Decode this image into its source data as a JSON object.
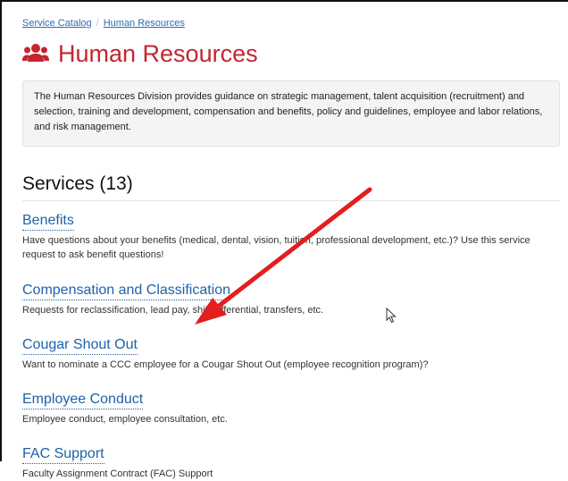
{
  "breadcrumb": {
    "items": [
      "Service Catalog",
      "Human Resources"
    ],
    "separator": "/"
  },
  "header": {
    "title": "Human Resources",
    "icon": "users-icon",
    "title_color": "#c3262e"
  },
  "description": "The Human Resources Division provides guidance on strategic management, talent acquisition (recruitment) and selection, training and development, compensation and benefits, policy and guidelines, employee and labor relations, and risk management.",
  "services": {
    "heading": "Services (13)",
    "items": [
      {
        "name": "Benefits",
        "desc": "Have questions about your benefits (medical, dental, vision, tuition, professional development, etc.)? Use this service request to ask benefit questions!"
      },
      {
        "name": "Compensation and Classification",
        "desc": "Requests for reclassification, lead pay, shift differential, transfers, etc."
      },
      {
        "name": "Cougar Shout Out",
        "desc": "Want to nominate a CCC employee for a Cougar Shout Out (employee recognition program)?"
      },
      {
        "name": "Employee Conduct",
        "desc": "Employee conduct, employee consultation, etc."
      },
      {
        "name": "FAC Support",
        "desc": "Faculty Assignment Contract (FAC) Support"
      }
    ]
  },
  "annotation": {
    "arrow_color": "#e31e1e",
    "icon": "red-arrow"
  }
}
